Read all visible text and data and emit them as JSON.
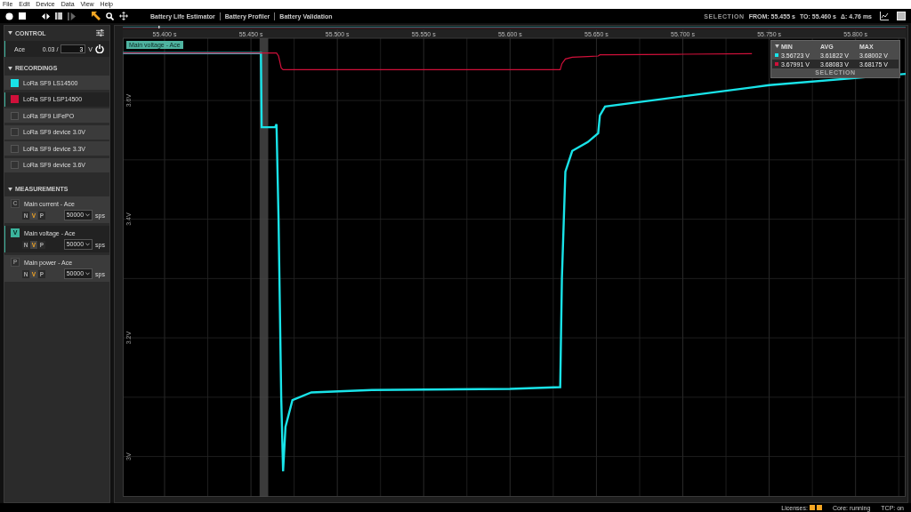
{
  "menu": [
    "File",
    "Edit",
    "Device",
    "Data",
    "View",
    "Help"
  ],
  "toolbar": {
    "tabs": [
      {
        "label": "Battery Life Estimator",
        "selected": false
      },
      {
        "label": "Battery Profiler",
        "selected": false
      },
      {
        "label": "Battery Validation",
        "selected": false
      }
    ],
    "selection": {
      "label": "SELECTION",
      "from": "FROM: 55.455 s",
      "to": "TO: 55.460 s",
      "delta": "Δ: 4.76 ms"
    }
  },
  "control": {
    "title": "CONTROL",
    "device": "Ace",
    "reading": "0.03 /",
    "value": "3",
    "unit": "V"
  },
  "recordings": {
    "title": "RECORDINGS",
    "items": [
      {
        "label": "LoRa SF9 LS14500",
        "checked": true,
        "color": "#19e3e8",
        "selected": false
      },
      {
        "label": "LoRa SF9 LSP14500",
        "checked": true,
        "color": "#d0103a",
        "selected": true
      },
      {
        "label": "LoRa SF9 LiFePO",
        "checked": false,
        "selected": false
      },
      {
        "label": "LoRa SF9 device 3.0V",
        "checked": false,
        "selected": false
      },
      {
        "label": "LoRa SF9 device 3.3V",
        "checked": false,
        "selected": false
      },
      {
        "label": "LoRa SF9 device 3.6V",
        "checked": false,
        "selected": false
      }
    ]
  },
  "measurements": {
    "title": "MEASUREMENTS",
    "items": [
      {
        "letter": "C",
        "label": "Main current - Ace",
        "active": false,
        "selected": false,
        "modes": [
          {
            "label": "N",
            "selected": false
          },
          {
            "label": "V",
            "selected": true
          },
          {
            "label": "P",
            "selected": false
          }
        ],
        "rate": "50000",
        "unit": "sps"
      },
      {
        "letter": "V",
        "label": "Main voltage - Ace",
        "active": true,
        "selected": true,
        "modes": [
          {
            "label": "N",
            "selected": false
          },
          {
            "label": "V",
            "selected": true
          },
          {
            "label": "P",
            "selected": false
          }
        ],
        "rate": "50000",
        "unit": "sps"
      },
      {
        "letter": "P",
        "label": "Main power - Ace",
        "active": false,
        "selected": false,
        "modes": [
          {
            "label": "N",
            "selected": false
          },
          {
            "label": "V",
            "selected": true
          },
          {
            "label": "P",
            "selected": false
          }
        ],
        "rate": "50000",
        "unit": "sps"
      }
    ]
  },
  "plot": {
    "label": "Main voltage - Ace",
    "stats": {
      "columns": [
        "MIN",
        "AVG",
        "MAX"
      ],
      "rows": [
        {
          "color": "#19e3e8",
          "selected": false,
          "values": [
            "3.56723 V",
            "3.61822 V",
            "3.68002 V"
          ]
        },
        {
          "color": "#d0103a",
          "selected": true,
          "values": [
            "3.67991 V",
            "3.68083 V",
            "3.68175 V"
          ]
        }
      ],
      "footer": "SELECTION"
    },
    "chart_data": {
      "type": "line",
      "x": [
        55.376,
        55.4558,
        55.4562,
        55.464,
        55.4648,
        55.466,
        55.4675,
        55.4686,
        55.47,
        55.474,
        55.485,
        55.52,
        55.6,
        55.629,
        55.63,
        55.632,
        55.636,
        55.645,
        55.651,
        55.652,
        55.655,
        55.7,
        55.74,
        55.75,
        55.829
      ],
      "series": [
        {
          "color": "#19e3e8",
          "values": [
            3.68,
            3.68,
            3.555,
            3.555,
            3.56,
            3.4,
            3.1,
            2.975,
            3.05,
            3.095,
            3.108,
            3.112,
            3.114,
            3.117,
            3.3,
            3.48,
            3.515,
            3.53,
            3.545,
            3.575,
            3.59,
            3.607,
            3.622,
            3.626,
            3.645
          ]
        },
        {
          "color": "#d0103a",
          "values": [
            3.68,
            3.68,
            3.68,
            3.68,
            3.68,
            3.675,
            3.655,
            3.652,
            3.652,
            3.652,
            3.652,
            3.652,
            3.652,
            3.652,
            3.662,
            3.67,
            3.673,
            3.674,
            3.675,
            3.677,
            3.677,
            3.678,
            3.679,
            null,
            null
          ]
        }
      ],
      "xlim": [
        55.3758,
        55.829
      ],
      "ylim": [
        2.932,
        3.705
      ],
      "xticks": [
        {
          "value": 55.4,
          "label": "55.400 s"
        },
        {
          "value": 55.45,
          "label": "55.450 s"
        },
        {
          "value": 55.5,
          "label": "55.500 s"
        },
        {
          "value": 55.55,
          "label": "55.550 s"
        },
        {
          "value": 55.6,
          "label": "55.600 s"
        },
        {
          "value": 55.65,
          "label": "55.650 s"
        },
        {
          "value": 55.7,
          "label": "55.700 s"
        },
        {
          "value": 55.75,
          "label": "55.750 s"
        },
        {
          "value": 55.8,
          "label": "55.800 s"
        }
      ],
      "yticks": [
        {
          "value": 3.6,
          "label": "3.6V"
        },
        {
          "value": 3.4,
          "label": "3.4V"
        },
        {
          "value": 3.2,
          "label": "3.2V"
        },
        {
          "value": 3.0,
          "label": "3V"
        }
      ],
      "grid": true,
      "bands": [
        {
          "axis": "x",
          "from": 55.455,
          "to": 55.46
        }
      ]
    }
  },
  "status": {
    "licenses": "Licenses:",
    "core": "Core: running",
    "tcp": "TCP: on"
  }
}
